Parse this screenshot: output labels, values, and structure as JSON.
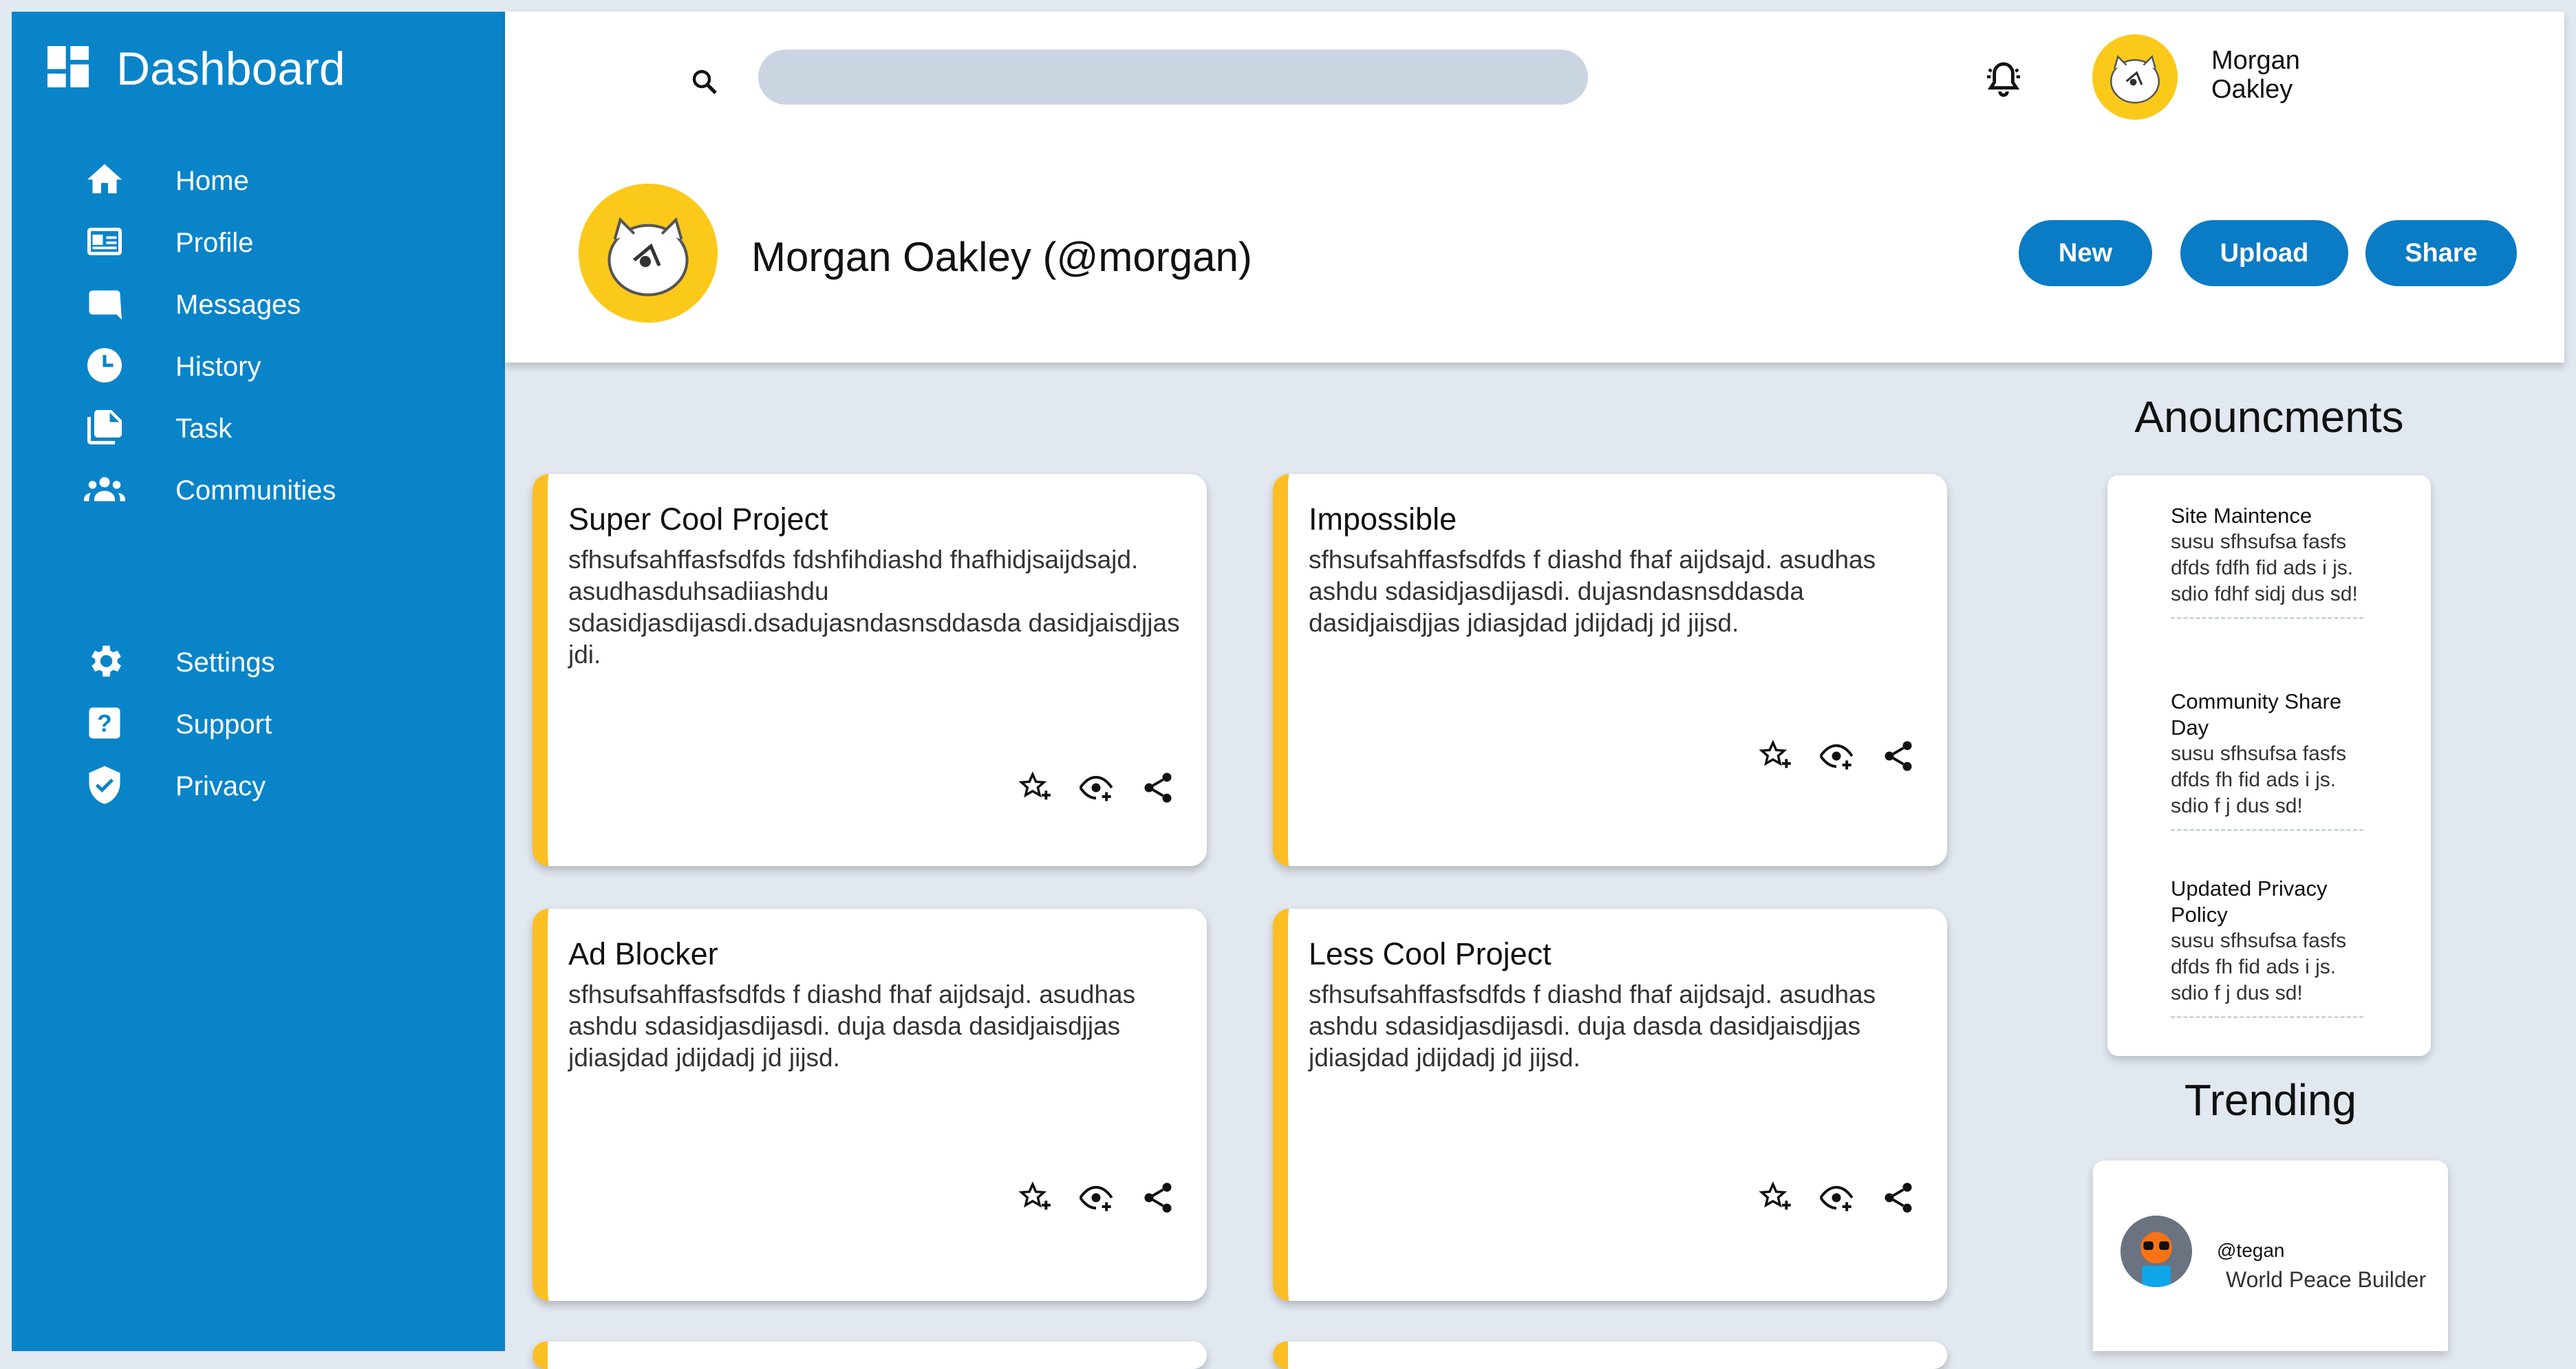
{
  "sidebar": {
    "brand": "Dashboard",
    "items": [
      {
        "label": "Home",
        "icon": "home-icon"
      },
      {
        "label": "Profile",
        "icon": "profile-card-icon"
      },
      {
        "label": "Messages",
        "icon": "message-icon"
      },
      {
        "label": "History",
        "icon": "clock-icon"
      },
      {
        "label": "Task",
        "icon": "document-icon"
      },
      {
        "label": "Communities",
        "icon": "people-icon"
      },
      {
        "label": "Settings",
        "icon": "gear-icon"
      },
      {
        "label": "Support",
        "icon": "help-icon"
      },
      {
        "label": "Privacy",
        "icon": "shield-icon"
      }
    ]
  },
  "header": {
    "search_placeholder": "",
    "user_name": "Morgan Oakley",
    "profile_title": "Morgan Oakley (@morgan)",
    "buttons": {
      "new": "New",
      "upload": "Upload",
      "share": "Share"
    }
  },
  "cards": [
    {
      "title": "Super Cool Project",
      "description": "sfhsufsahffasfsdfds fdshfihdiashd fhafhidjsaijdsajd. asudhasduhsadiiashdu sdasidjasdijasdi.dsadujasndasnsddasda dasidjaisdjjas jdi."
    },
    {
      "title": "Impossible",
      "description": "sfhsufsahffasfsdfds f diashd fhaf aijdsajd. asudhas ashdu sdasidjasdijasdi. dujasndasnsddasda dasidjaisdjjas jdiasjdad jdijdadj jd jijsd."
    },
    {
      "title": "Ad Blocker",
      "description": "sfhsufsahffasfsdfds f diashd fhaf aijdsajd. asudhas ashdu sdasidjasdijasdi. duja dasda dasidjaisdjjas jdiasjdad jdijdadj jd jijsd."
    },
    {
      "title": "Less Cool Project",
      "description": "sfhsufsahffasfsdfds f diashd fhaf aijdsajd. asudhas ashdu sdasidjasdijasdi. duja dasda dasidjaisdjjas jdiasjdad jdijdadj jd jijsd."
    }
  ],
  "announcements": {
    "heading": "Anouncments",
    "items": [
      {
        "title": "Site Maintence",
        "text": "susu sfhsufsa fasfs dfds fdfh fid ads i js. sdio fdhf sidj dus sd!"
      },
      {
        "title": "Community Share Day",
        "text": "susu sfhsufsa fasfs dfds fh fid ads i js. sdio f j dus sd!"
      },
      {
        "title": "Updated Privacy Policy",
        "text": "susu sfhsufsa fasfs dfds fh fid ads i js. sdio f j dus sd!"
      }
    ]
  },
  "trending": {
    "heading": "Trending",
    "items": [
      {
        "handle": "@tegan",
        "description": "World Peace Builder"
      }
    ]
  },
  "colors": {
    "sidebar": "#0a84c9",
    "button": "#0a7bc5",
    "card_accent": "#fbbf24",
    "avatar_bg": "#fbc91a",
    "background": "#e2e8f0"
  }
}
